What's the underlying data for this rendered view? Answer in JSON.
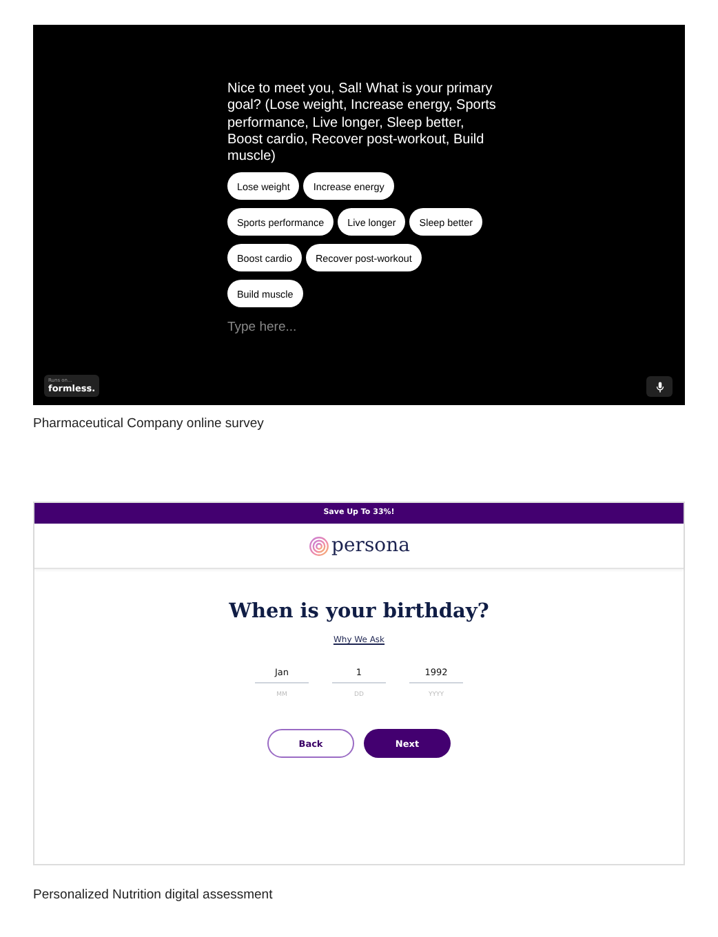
{
  "examples": [
    {
      "kind": "chat_survey",
      "question": "Nice to meet you, Sal! What is your primary goal? (Lose weight, Increase energy, Sports performance, Live longer, Sleep better, Boost cardio, Recover post-workout, Build muscle)",
      "options": [
        "Lose weight",
        "Increase energy",
        "Sports performance",
        "Live longer",
        "Sleep better",
        "Boost cardio",
        "Recover post-workout",
        "Build muscle"
      ],
      "input": {
        "placeholder": "Type here..."
      },
      "badge": {
        "caption": "Runs on...",
        "brand": "formless."
      },
      "caption": "Pharmaceutical Company online survey"
    },
    {
      "kind": "form_page",
      "banner": "Save Up To 33%!",
      "logo": "persona",
      "heading": "When is your birthday?",
      "link": "Why We Ask",
      "date_fields": [
        {
          "value": "Jan",
          "hint": "MM"
        },
        {
          "value": "1",
          "hint": "DD"
        },
        {
          "value": "1992",
          "hint": "YYYY"
        }
      ],
      "buttons": [
        {
          "label": "Back",
          "kind": "secondary"
        },
        {
          "label": "Next",
          "kind": "primary"
        }
      ],
      "caption": "Personalized Nutrition digital assessment"
    }
  ]
}
